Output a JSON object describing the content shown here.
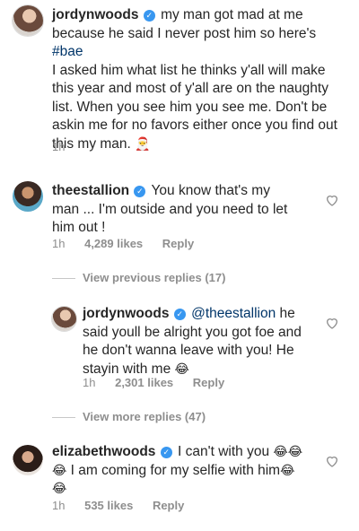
{
  "caption": {
    "username": "jordynwoods",
    "line1": "my man got mad at me",
    "line2": "because he said I never post him so here's",
    "hashtag": "#bae",
    "lines": [
      "I asked him what list he thinks y'all will make",
      "this year and most of y'all are on the naughty",
      "list. When you see him you see me. Don't be",
      "askin me for no favors either once you find out"
    ],
    "last_line": "this my man.",
    "emoji": "🎅",
    "time": "1h"
  },
  "comments": [
    {
      "username": "theestallion",
      "line1": "You know that's my",
      "line2": "man ... I'm outside and you need to let",
      "line3": "him out !",
      "time": "1h",
      "likes": "4,289 likes",
      "reply": "Reply"
    },
    {
      "username": "jordynwoods",
      "mention": "@theestallion",
      "line1_tail": "he",
      "line2": "said youll be alright you got foe and",
      "line3": "he don't wanna leave with you! He",
      "line4": "stayin with me",
      "emoji": "😂",
      "time": "1h",
      "likes": "2,301 likes",
      "reply": "Reply"
    },
    {
      "username": "elizabethwoods",
      "line1": "I can't with you",
      "line2": "I am coming for my selfie with him",
      "emoji": "😂",
      "time": "1h",
      "likes": "535 likes",
      "reply": "Reply"
    }
  ],
  "view_previous": "View previous replies (17)",
  "view_more": "View more replies (47)",
  "icons": {
    "heart": "heart-outline-icon",
    "verified": "verified-badge-icon"
  },
  "colors": {
    "verified": "#3897f0",
    "hashtag": "#003569",
    "meta": "#8e8e8e"
  }
}
